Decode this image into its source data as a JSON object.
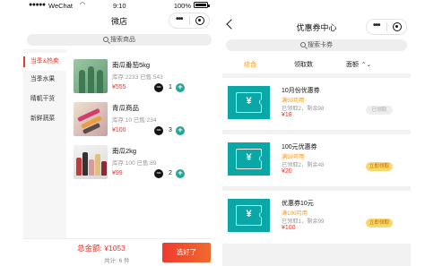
{
  "status_bar": {
    "carrier": "WeChat",
    "time": "9:10",
    "battery": "100%"
  },
  "shop": {
    "title": "微店",
    "search_placeholder": "搜索商品",
    "categories": [
      {
        "label": "当季&热卖",
        "active": true
      },
      {
        "label": "当季水果",
        "active": false
      },
      {
        "label": "睛軏干货",
        "active": false
      },
      {
        "label": "新鲜蔬菜",
        "active": false
      }
    ],
    "products": [
      {
        "name": "南瓜番茄5kg",
        "meta": "库存:2233 已售:543",
        "price": "¥555",
        "qty": "1"
      },
      {
        "name": "青瓜商品",
        "meta": "库存:10 已售:234",
        "price": "¥100",
        "qty": "3"
      },
      {
        "name": "南瓜2kg",
        "meta": "库存:100 已售:89",
        "price": "¥99",
        "qty": "2"
      }
    ],
    "total_label": "总金额:",
    "total_value": "¥1053",
    "count_text": "共计: 6 件",
    "checkout_label": "选好了"
  },
  "coupon_center": {
    "title": "优惠券中心",
    "search_placeholder": "搜索卡券",
    "tabs": [
      {
        "label": "综合",
        "active": true
      },
      {
        "label": "领取数",
        "active": false
      },
      {
        "label": "面额",
        "active": false
      }
    ],
    "coupons": [
      {
        "title": "10月份优惠券",
        "cond": "满50可用",
        "stats": "已领取2，剩余98",
        "amount": "¥18",
        "action": "已领取",
        "state": "claimed"
      },
      {
        "title": "100元优惠券",
        "cond": "满50可用",
        "stats": "已领取2，剩余48",
        "amount": "¥20",
        "action": "立即领取",
        "state": "claim"
      },
      {
        "title": "优惠券10元",
        "cond": "满100可用",
        "stats": "已领取1，剩余99",
        "amount": "¥100",
        "action": "立即领取",
        "state": "claim"
      }
    ]
  },
  "colors": {
    "accent_red": "#e8382f",
    "accent_orange": "#f39a1c",
    "teal": "#0ba7a7",
    "plus_teal": "#29a39a"
  },
  "icons": [
    "search-icon",
    "more-icon",
    "close-mini-icon",
    "back-icon",
    "yen-ticket-icon",
    "chevron-sort-icon",
    "battery-icon"
  ]
}
